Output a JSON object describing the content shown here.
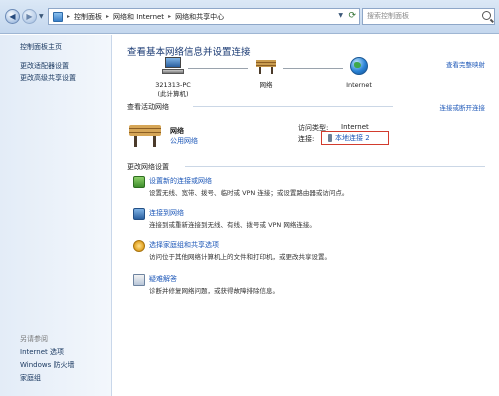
{
  "address_bar": {
    "crumbs": [
      "控制面板",
      "网络和 Internet",
      "网络和共享中心"
    ],
    "search_placeholder": "搜索控制面板"
  },
  "sidebar": {
    "home": "控制面板主页",
    "links": [
      "更改适配器设置",
      "更改高级共享设置"
    ],
    "see_also_title": "另请参阅",
    "see_also": [
      "Internet 选项",
      "Windows 防火墙",
      "家庭组"
    ]
  },
  "main": {
    "title": "查看基本网络信息并设置连接",
    "view_full_map": "查看完整映射",
    "map": {
      "pc_name": "321313-PC",
      "pc_sub": "(此计算机)",
      "network": "网络",
      "internet": "Internet"
    },
    "active_networks_head": "查看活动网络",
    "connect_disconnect": "连接或断开连接",
    "active": {
      "name": "网络",
      "type": "公用网络",
      "access_label": "访问类型:",
      "access_value": "Internet",
      "connection_label": "连接:",
      "connection_value": "本地连接 2"
    },
    "change_settings_head": "更改网络设置",
    "tasks": [
      {
        "title": "设置新的连接或网络",
        "desc": "设置无线、宽带、拨号、临时或 VPN 连接；或设置路由器或访问点。",
        "icon": "network-setup-icon"
      },
      {
        "title": "连接到网络",
        "desc": "连接到或重新连接到无线、有线、拨号或 VPN 网络连接。",
        "icon": "connect-network-icon"
      },
      {
        "title": "选择家庭组和共享选项",
        "desc": "访问位于其他网络计算机上的文件和打印机，或更改共享设置。",
        "icon": "homegroup-icon"
      },
      {
        "title": "疑难解答",
        "desc": "诊断并修复网络问题，或获得故障排除信息。",
        "icon": "troubleshoot-icon"
      }
    ]
  }
}
